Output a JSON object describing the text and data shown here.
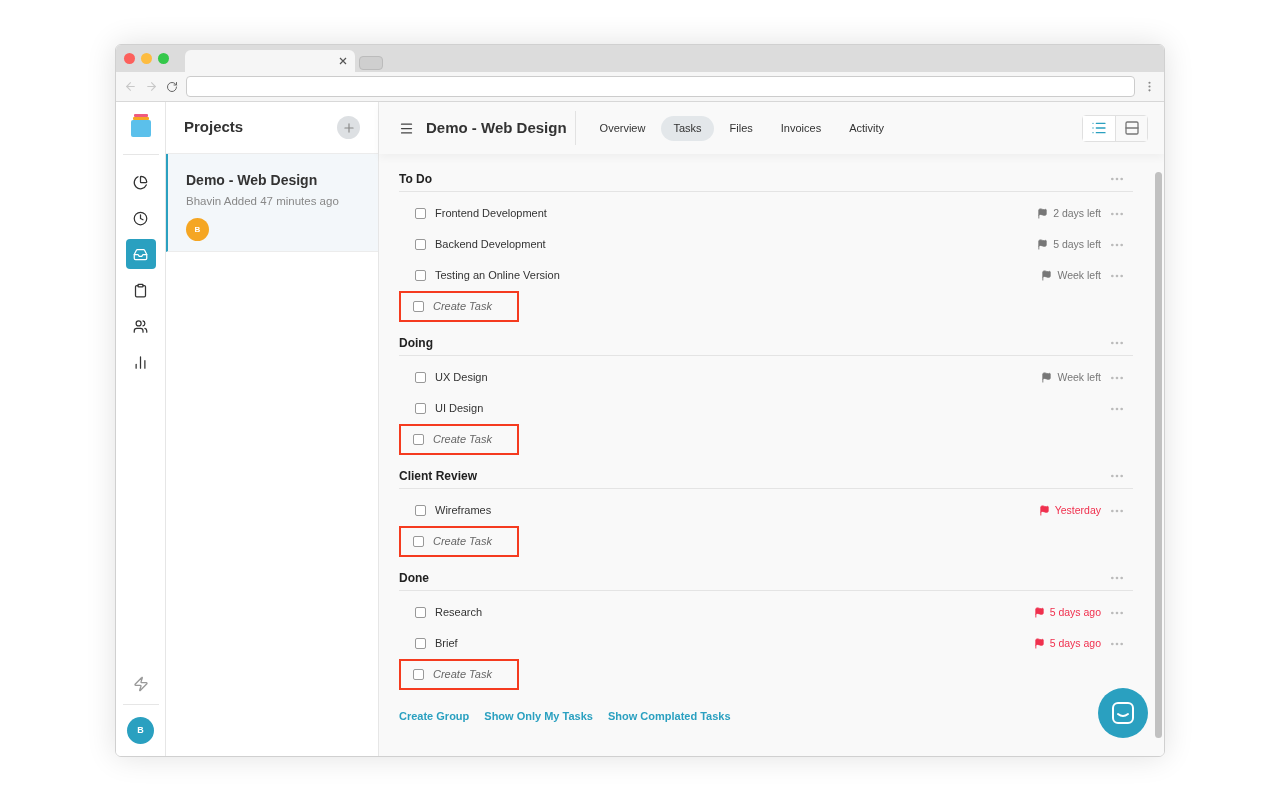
{
  "sidebar": {
    "items": [
      {
        "kind": "pie",
        "selected": false
      },
      {
        "kind": "clock",
        "selected": false
      },
      {
        "kind": "inbox",
        "selected": true
      },
      {
        "kind": "clipboard",
        "selected": false
      },
      {
        "kind": "users",
        "selected": false
      },
      {
        "kind": "chart",
        "selected": false
      }
    ],
    "user_initial": "B"
  },
  "projects": {
    "title": "Projects",
    "items": [
      {
        "name": "Demo - Web Design",
        "meta": "Bhavin Added 47 minutes ago",
        "member_initial": "B",
        "selected": true
      }
    ]
  },
  "header": {
    "title": "Demo - Web Design",
    "tabs": [
      {
        "label": "Overview",
        "selected": false
      },
      {
        "label": "Tasks",
        "selected": true
      },
      {
        "label": "Files",
        "selected": false
      },
      {
        "label": "Invoices",
        "selected": false
      },
      {
        "label": "Activity",
        "selected": false
      }
    ],
    "views": [
      {
        "kind": "list",
        "selected": true
      },
      {
        "kind": "cards",
        "selected": false
      }
    ]
  },
  "groups": [
    {
      "title": "To Do",
      "tasks": [
        {
          "name": "Frontend Development",
          "checked": false,
          "due": "2 days left",
          "overdue": false
        },
        {
          "name": "Backend Development",
          "checked": false,
          "due": "5 days left",
          "overdue": false
        },
        {
          "name": "Testing an Online Version",
          "checked": false,
          "due": "Week left",
          "overdue": false
        }
      ],
      "create_placeholder": "Create Task",
      "highlighted": true
    },
    {
      "title": "Doing",
      "tasks": [
        {
          "name": "UX Design",
          "checked": false,
          "due": "Week left",
          "overdue": false
        },
        {
          "name": "UI Design",
          "checked": false
        }
      ],
      "create_placeholder": "Create Task",
      "highlighted": true
    },
    {
      "title": "Client Review",
      "tasks": [
        {
          "name": "Wireframes",
          "checked": false,
          "due": "Yesterday",
          "overdue": true
        }
      ],
      "create_placeholder": "Create Task",
      "highlighted": true
    },
    {
      "title": "Done",
      "tasks": [
        {
          "name": "Research",
          "checked": false,
          "due": "5 days ago",
          "overdue": true
        },
        {
          "name": "Brief",
          "checked": false,
          "due": "5 days ago",
          "overdue": true
        }
      ],
      "create_placeholder": "Create Task",
      "highlighted": true
    }
  ],
  "footer_links": [
    "Create Group",
    "Show Only My Tasks",
    "Show Complated Tasks"
  ]
}
